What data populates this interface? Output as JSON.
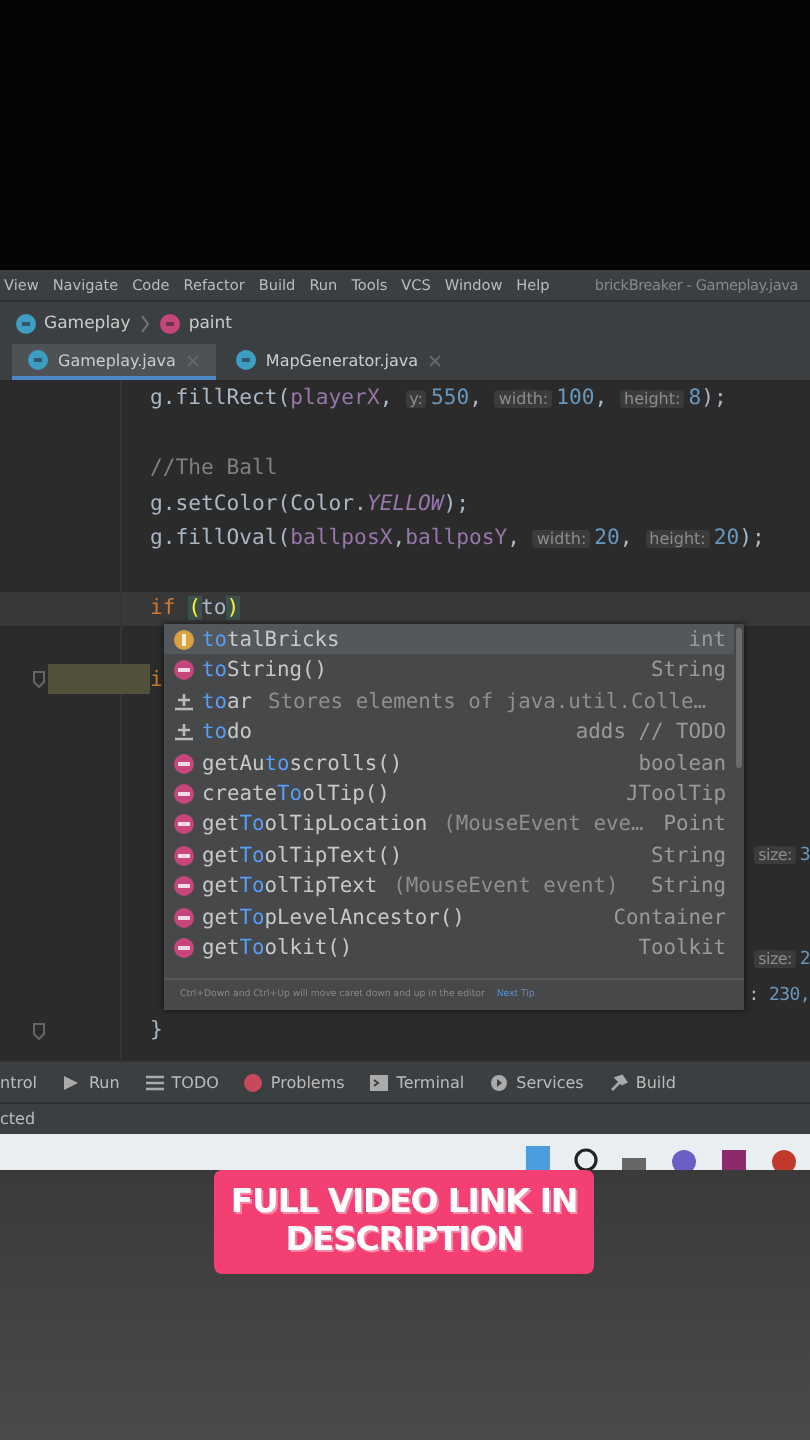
{
  "menu_bar": {
    "items": [
      "View",
      "Navigate",
      "Code",
      "Refactor",
      "Build",
      "Run",
      "Tools",
      "VCS",
      "Window",
      "Help"
    ],
    "title": "brickBreaker - Gameplay.java"
  },
  "breadcrumbs": [
    {
      "label": "Gameplay",
      "kind": "class"
    },
    {
      "label": "paint",
      "kind": "method"
    }
  ],
  "tabs": [
    {
      "label": "Gameplay.java",
      "selected": true
    },
    {
      "label": "MapGenerator.java",
      "selected": false
    }
  ],
  "editor": {
    "lines": [
      {
        "kind": "code",
        "segments": [
          {
            "kind": "plain",
            "text": "g.fillRect("
          },
          {
            "kind": "field",
            "text": "playerX"
          },
          {
            "kind": "plain",
            "text": ", "
          },
          {
            "kind": "hint",
            "text": "y:"
          },
          {
            "kind": "num",
            "text": "550"
          },
          {
            "kind": "plain",
            "text": ", "
          },
          {
            "kind": "hint",
            "text": "width:"
          },
          {
            "kind": "num",
            "text": "100"
          },
          {
            "kind": "plain",
            "text": ", "
          },
          {
            "kind": "hint",
            "text": "height:"
          },
          {
            "kind": "num",
            "text": "8"
          },
          {
            "kind": "plain",
            "text": ");"
          }
        ]
      },
      {
        "kind": "blank"
      },
      {
        "kind": "code",
        "segments": [
          {
            "kind": "comment",
            "text": "//The Ball"
          }
        ]
      },
      {
        "kind": "code",
        "segments": [
          {
            "kind": "plain",
            "text": "g.setColor(Color."
          },
          {
            "kind": "const",
            "text": "YELLOW"
          },
          {
            "kind": "plain",
            "text": ");"
          }
        ]
      },
      {
        "kind": "code",
        "segments": [
          {
            "kind": "plain",
            "text": "g.fillOval("
          },
          {
            "kind": "field",
            "text": "ballposX"
          },
          {
            "kind": "plain",
            "text": ","
          },
          {
            "kind": "field",
            "text": "ballposY"
          },
          {
            "kind": "plain",
            "text": ", "
          },
          {
            "kind": "hint",
            "text": "width:"
          },
          {
            "kind": "num",
            "text": "20"
          },
          {
            "kind": "plain",
            "text": ", "
          },
          {
            "kind": "hint",
            "text": "height:"
          },
          {
            "kind": "num",
            "text": "20"
          },
          {
            "kind": "plain",
            "text": ");"
          }
        ]
      },
      {
        "kind": "blank"
      },
      {
        "kind": "code",
        "current": true,
        "segments": [
          {
            "kind": "keyword",
            "text": "if "
          },
          {
            "kind": "brace",
            "text": "("
          },
          {
            "kind": "plain",
            "text": "to"
          },
          {
            "kind": "brace",
            "text": ")"
          }
        ]
      },
      {
        "kind": "blank"
      },
      {
        "kind": "code",
        "highlight": true,
        "fold": true,
        "segments": [
          {
            "kind": "keyword",
            "text": "i"
          }
        ]
      },
      {
        "kind": "blank"
      },
      {
        "kind": "blank"
      },
      {
        "kind": "blank"
      },
      {
        "kind": "blank"
      },
      {
        "kind": "code",
        "right": [
          {
            "kind": "hint",
            "text": "size:"
          },
          {
            "kind": "num",
            "text": "3"
          }
        ]
      },
      {
        "kind": "blank"
      },
      {
        "kind": "blank"
      },
      {
        "kind": "code",
        "right": [
          {
            "kind": "hint",
            "text": "size:"
          },
          {
            "kind": "num",
            "text": "2"
          }
        ]
      },
      {
        "kind": "code",
        "right": [
          {
            "kind": "plain",
            "text": ": "
          },
          {
            "kind": "num",
            "text": "230,"
          }
        ]
      },
      {
        "kind": "code",
        "fold": true,
        "segments": [
          {
            "kind": "plain",
            "text": "}"
          }
        ]
      }
    ]
  },
  "completion": {
    "items": [
      {
        "kind": "field",
        "name": [
          {
            "text": "to",
            "match": true
          },
          {
            "text": "talBricks",
            "match": false
          }
        ],
        "type": "int",
        "selected": true
      },
      {
        "kind": "method",
        "name": [
          {
            "text": "to",
            "match": true
          },
          {
            "text": "String()",
            "match": false
          }
        ],
        "type": "String",
        "selected": false
      },
      {
        "kind": "template",
        "name": [
          {
            "text": "to",
            "match": true
          },
          {
            "text": "ar",
            "match": false
          }
        ],
        "detail": "Stores elements of java.util.Colle…",
        "selected": false
      },
      {
        "kind": "template",
        "name": [
          {
            "text": "to",
            "match": true
          },
          {
            "text": "do",
            "match": false
          }
        ],
        "type": "adds // TODO",
        "selected": false
      },
      {
        "kind": "method",
        "name": [
          {
            "text": "getAu",
            "match": false
          },
          {
            "text": "to",
            "match": true
          },
          {
            "text": "scrolls()",
            "match": false
          }
        ],
        "type": "boolean",
        "selected": false
      },
      {
        "kind": "method",
        "name": [
          {
            "text": "create",
            "match": false
          },
          {
            "text": "To",
            "match": true
          },
          {
            "text": "olTip()",
            "match": false
          }
        ],
        "type": "JToolTip",
        "selected": false
      },
      {
        "kind": "method",
        "name": [
          {
            "text": "get",
            "match": false
          },
          {
            "text": "To",
            "match": true
          },
          {
            "text": "olTipLocation",
            "match": false
          }
        ],
        "detail": "(MouseEvent eve…",
        "type": "Point",
        "selected": false
      },
      {
        "kind": "method",
        "name": [
          {
            "text": "get",
            "match": false
          },
          {
            "text": "To",
            "match": true
          },
          {
            "text": "olTipText()",
            "match": false
          }
        ],
        "type": "String",
        "selected": false
      },
      {
        "kind": "method",
        "name": [
          {
            "text": "get",
            "match": false
          },
          {
            "text": "To",
            "match": true
          },
          {
            "text": "olTipText",
            "match": false
          }
        ],
        "detail": "(MouseEvent event)",
        "type": "String",
        "selected": false
      },
      {
        "kind": "method",
        "name": [
          {
            "text": "get",
            "match": false
          },
          {
            "text": "To",
            "match": true
          },
          {
            "text": "pLevelAncestor()",
            "match": false
          }
        ],
        "type": "Container",
        "selected": false
      },
      {
        "kind": "method",
        "name": [
          {
            "text": "get",
            "match": false
          },
          {
            "text": "To",
            "match": true
          },
          {
            "text": "olkit()",
            "match": false
          }
        ],
        "type": "Toolkit",
        "selected": false
      }
    ],
    "footer": {
      "hint": "Ctrl+Down and Ctrl+Up will move caret down and up in the editor",
      "link": "Next Tip"
    }
  },
  "tool_windows": [
    {
      "label": "ntrol",
      "kind": "none"
    },
    {
      "label": "Run",
      "kind": "run"
    },
    {
      "label": "TODO",
      "kind": "todo"
    },
    {
      "label": "Problems",
      "kind": "problems"
    },
    {
      "label": "Terminal",
      "kind": "terminal"
    },
    {
      "label": "Services",
      "kind": "services"
    },
    {
      "label": "Build",
      "kind": "build"
    }
  ],
  "status": "cted",
  "banner": {
    "text": "FULL VIDEO LINK IN DESCRIPTION"
  }
}
